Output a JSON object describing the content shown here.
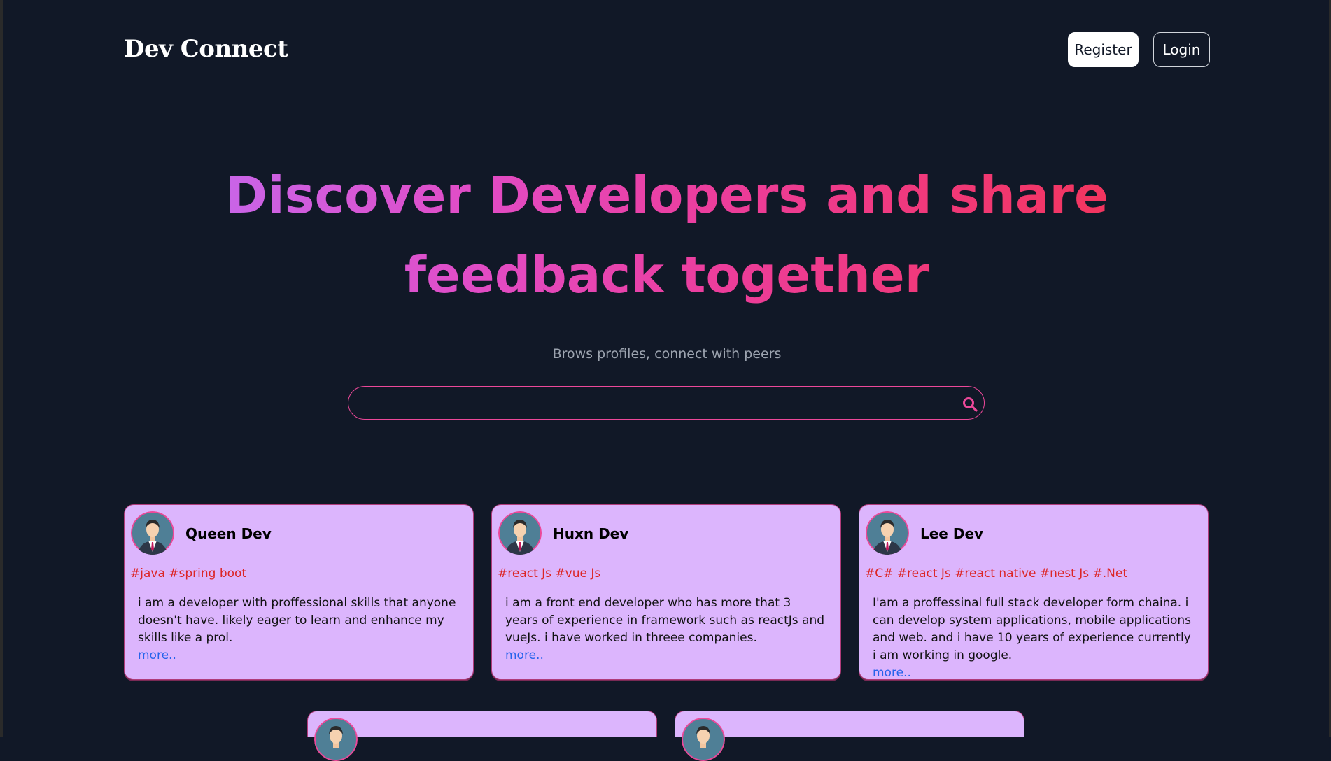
{
  "brand": {
    "name": "Dev Connect"
  },
  "nav": {
    "register_label": "Register",
    "login_label": "Login"
  },
  "hero": {
    "title": "Discover Developers and share feedback together",
    "subtitle": "Brows profiles, connect with peers"
  },
  "search": {
    "value": "",
    "placeholder": ""
  },
  "colors": {
    "background": "#111827",
    "accent": "#ec4899",
    "card_background": "#dcb5fd",
    "tag": "#dc2626",
    "link": "#2563eb"
  },
  "profiles": [
    {
      "name": "Queen Dev",
      "tags": "#java #spring boot",
      "bio": "i am a developer with proffessional skills that anyone doesn't have. likely eager to learn and enhance my skills like a prol.",
      "more_label": "more.."
    },
    {
      "name": "Huxn Dev",
      "tags": "#react Js #vue Js",
      "bio": "i am a front end developer who has more that 3 years of experience in framework such as reactJs and vueJs. i have worked in threee companies.",
      "more_label": "more.."
    },
    {
      "name": "Lee Dev",
      "tags": "#C# #react Js #react native #nest Js #.Net",
      "bio": "I'am a proffessinal full stack developer form chaina. i can develop system applications, mobile applications and web. and i have 10 years of experience currently i am working in google.",
      "more_label": "more.."
    }
  ],
  "icons": {
    "search": "search-icon",
    "avatar": "avatar-icon"
  }
}
